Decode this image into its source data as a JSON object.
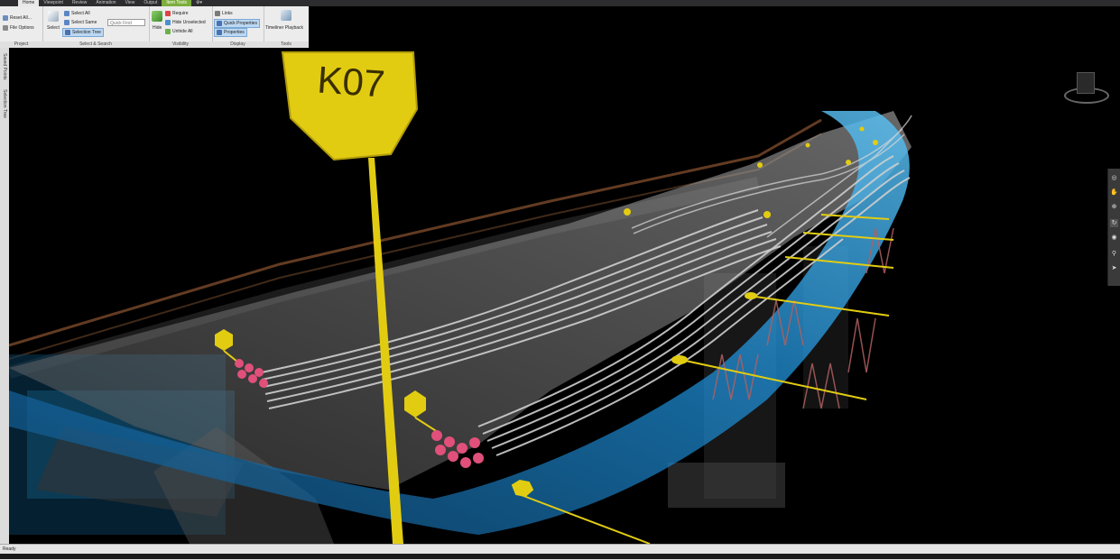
{
  "ribbon": {
    "tabs": [
      "Home",
      "Viewpoint",
      "Review",
      "Animation",
      "View",
      "Output",
      "Item Tools"
    ],
    "active_tab": "Home",
    "groups": {
      "project": {
        "label": "Project",
        "reset_all": "Reset All...",
        "file_options": "File Options"
      },
      "select_search": {
        "label": "Select & Search",
        "select": "Select",
        "select_all": "Select All",
        "select_same": "Select Same",
        "selection_tree": "Selection Tree",
        "quick_find_placeholder": "Quick Find"
      },
      "visibility": {
        "label": "Visibility",
        "hide": "Hide",
        "require": "Require",
        "hide_unselected": "Hide Unselected",
        "unhide_all": "Unhide All"
      },
      "display": {
        "label": "Display",
        "links": "Links",
        "quick_properties": "Quick Properties",
        "properties": "Properties"
      },
      "tools": {
        "label": "Tools",
        "timeliner_playback": "Timeliner Playback"
      }
    }
  },
  "side_tabs": [
    "Saved Points",
    "Selection Tree"
  ],
  "viewport": {
    "sign_text": "K07",
    "colors": {
      "background": "#000000",
      "deck_cyan": "#1e8fd8",
      "sign_yellow": "#e2cc12",
      "tendons": "#c9c9c9",
      "anchors": "#e0507a",
      "piles": "#b06060"
    }
  },
  "status": {
    "text": "Ready"
  }
}
